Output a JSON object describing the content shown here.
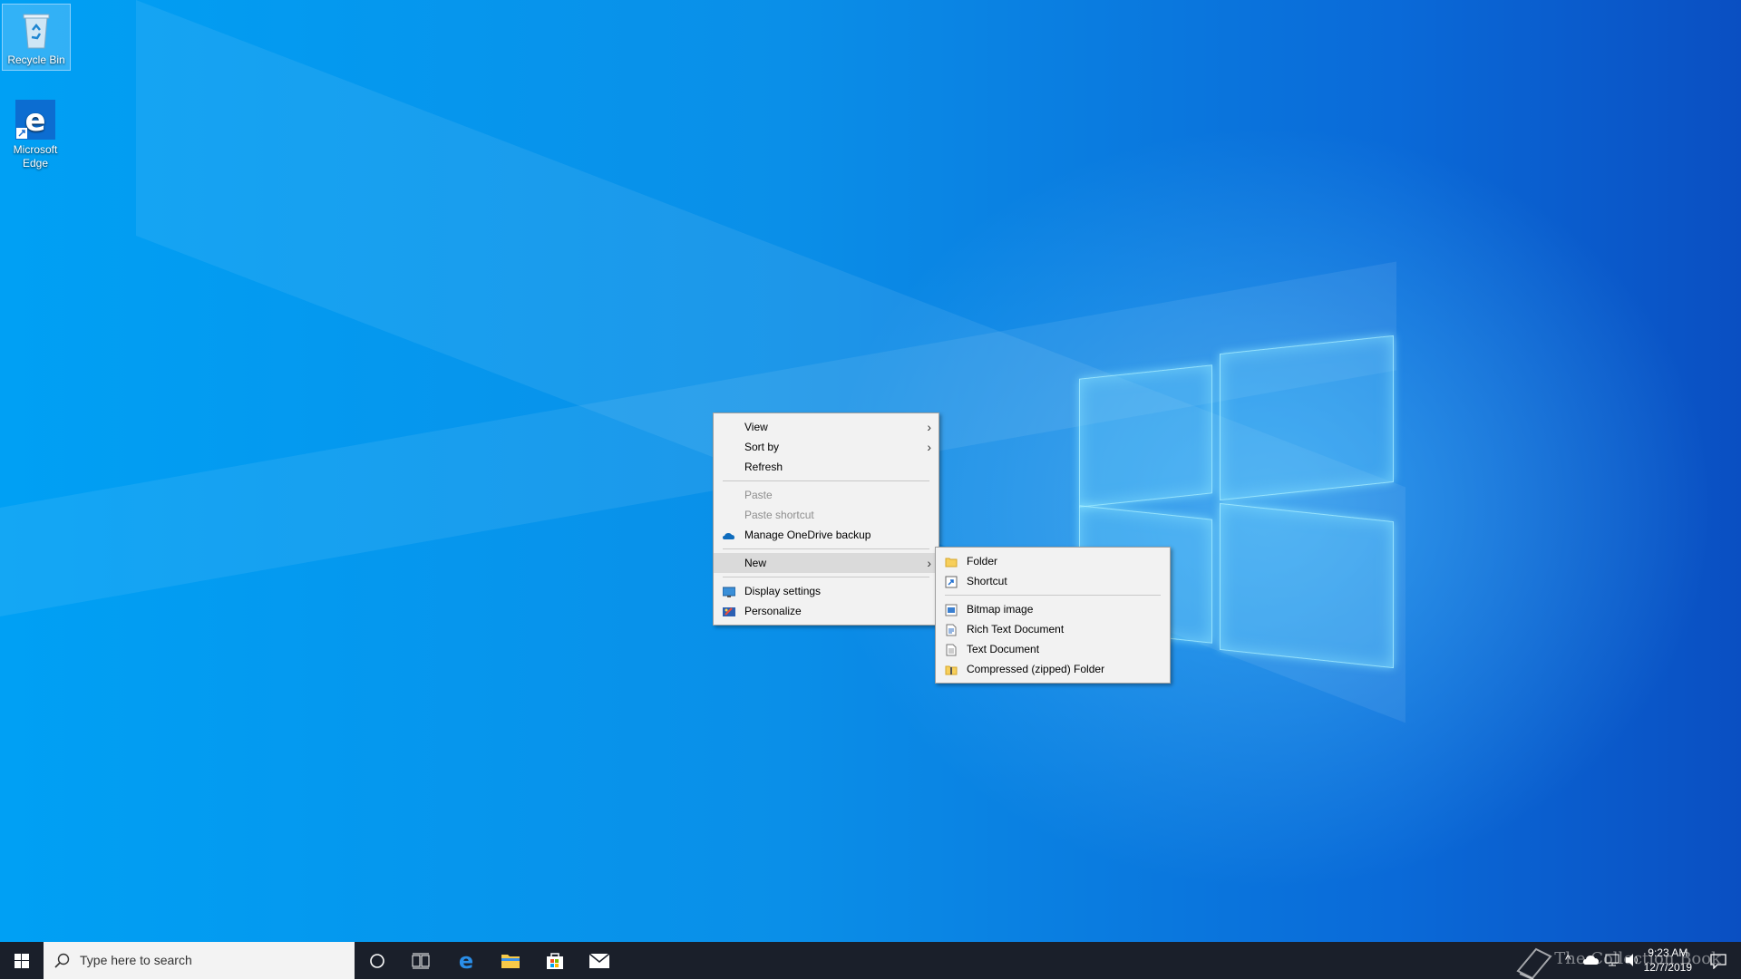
{
  "desktop_icons": [
    {
      "label": "Recycle Bin",
      "icon": "recycle-bin-icon"
    },
    {
      "label": "Microsoft Edge",
      "icon": "edge-icon"
    }
  ],
  "context_menu": {
    "view": "View",
    "sort_by": "Sort by",
    "refresh": "Refresh",
    "paste": "Paste",
    "paste_shortcut": "Paste shortcut",
    "manage_onedrive": "Manage OneDrive backup",
    "new": "New",
    "display_settings": "Display settings",
    "personalize": "Personalize"
  },
  "new_submenu": {
    "folder": "Folder",
    "shortcut": "Shortcut",
    "bitmap": "Bitmap image",
    "rich_text": "Rich Text Document",
    "text_doc": "Text Document",
    "zip_folder": "Compressed (zipped) Folder"
  },
  "taskbar": {
    "search_placeholder": "Type here to search",
    "time": "9:23 AM",
    "date": "12/7/2019",
    "watermark": "The Collection Book"
  },
  "colors": {
    "accent": "#0078d7",
    "taskbar_bg": "#1a1f2a",
    "menu_bg": "#f2f2f2"
  }
}
